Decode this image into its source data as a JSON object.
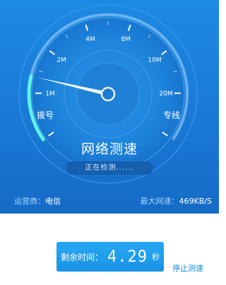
{
  "gauge": {
    "ticks": [
      "1M",
      "2M",
      "4M",
      "8M",
      "10M",
      "20M"
    ],
    "left_label": "拨号",
    "right_label": "专线",
    "needle_tick_position": 1.35
  },
  "header": {
    "title": "网络测速",
    "status": "正在检测......"
  },
  "info": {
    "carrier_label": "运营商：",
    "carrier_value": "电信",
    "max_label": "最大网速：",
    "max_value": "469KB/S"
  },
  "footer": {
    "remain_label": "剩余时间：",
    "remain_value": "4.29",
    "remain_unit": "秒",
    "stop_label": "停止测速"
  },
  "colors": {
    "accent": "#1a8ae0",
    "arc_progress": "#5ef2e4"
  }
}
